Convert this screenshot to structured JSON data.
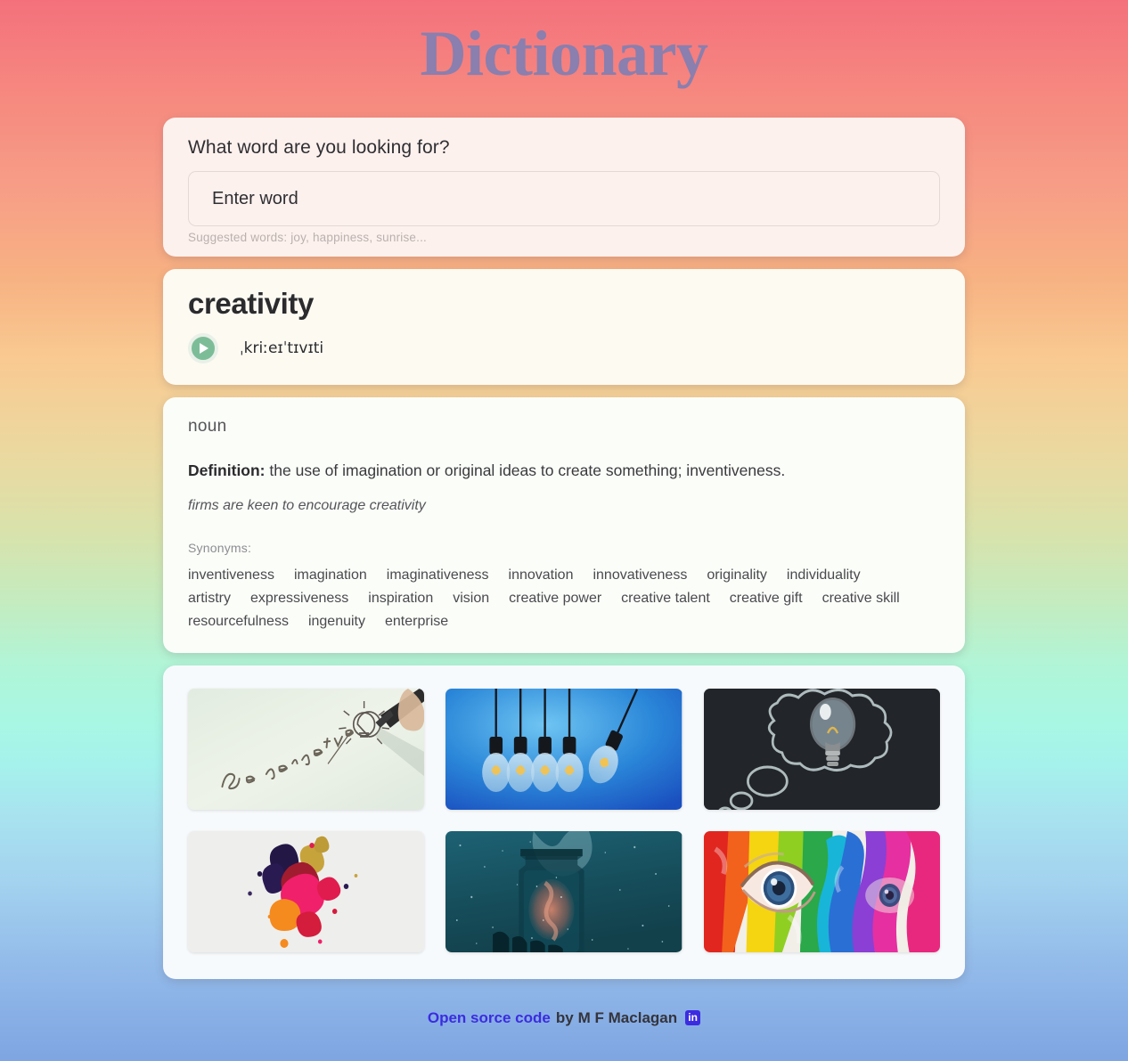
{
  "app": {
    "title": "Dictionary",
    "title_color": "#8a7fae"
  },
  "search": {
    "label": "What word are you looking for?",
    "placeholder": "Enter word",
    "value": "",
    "hint": "Suggested words: joy, happiness, sunrise..."
  },
  "word": {
    "term": "creativity",
    "phonetic": "ˌkriːeɪˈtɪvɪti",
    "play_button_color": "#7cbd98"
  },
  "meaning": {
    "part_of_speech": "noun",
    "definition_label": "Definition:",
    "definition_text": "the use of imagination or original ideas to create something; inventiveness.",
    "example": "firms are keen to encourage creativity",
    "synonyms_label": "Synonyms:",
    "synonyms": [
      "inventiveness",
      "imagination",
      "imaginativeness",
      "innovation",
      "innovativeness",
      "originality",
      "individuality",
      "artistry",
      "expressiveness",
      "inspiration",
      "vision",
      "creative power",
      "creative talent",
      "creative gift",
      "creative skill",
      "resourcefulness",
      "ingenuity",
      "enterprise"
    ]
  },
  "gallery": {
    "images": [
      {
        "id": "be-creative-handwriting",
        "alt": "Handwritten 'Be creative' with lightbulb doodle on pale green paper"
      },
      {
        "id": "hanging-lightbulbs",
        "alt": "Newton's cradle of hanging lightbulbs on blue background"
      },
      {
        "id": "chalkboard-thought-bubble",
        "alt": "Chalk thought bubble on blackboard with real lightbulb"
      },
      {
        "id": "paint-splash",
        "alt": "Colorful paint splash on white background"
      },
      {
        "id": "galaxy-in-jar",
        "alt": "Glass jar holding a galaxy against teal starry sky"
      },
      {
        "id": "rainbow-face-paint",
        "alt": "Close-up of blue eye surrounded by rainbow face paint"
      }
    ]
  },
  "footer": {
    "link_text": "Open sorce code",
    "by_text": "by",
    "author": "M F Maclagan",
    "social_icon": "linkedin-icon",
    "link_color": "#3b2ce0"
  }
}
